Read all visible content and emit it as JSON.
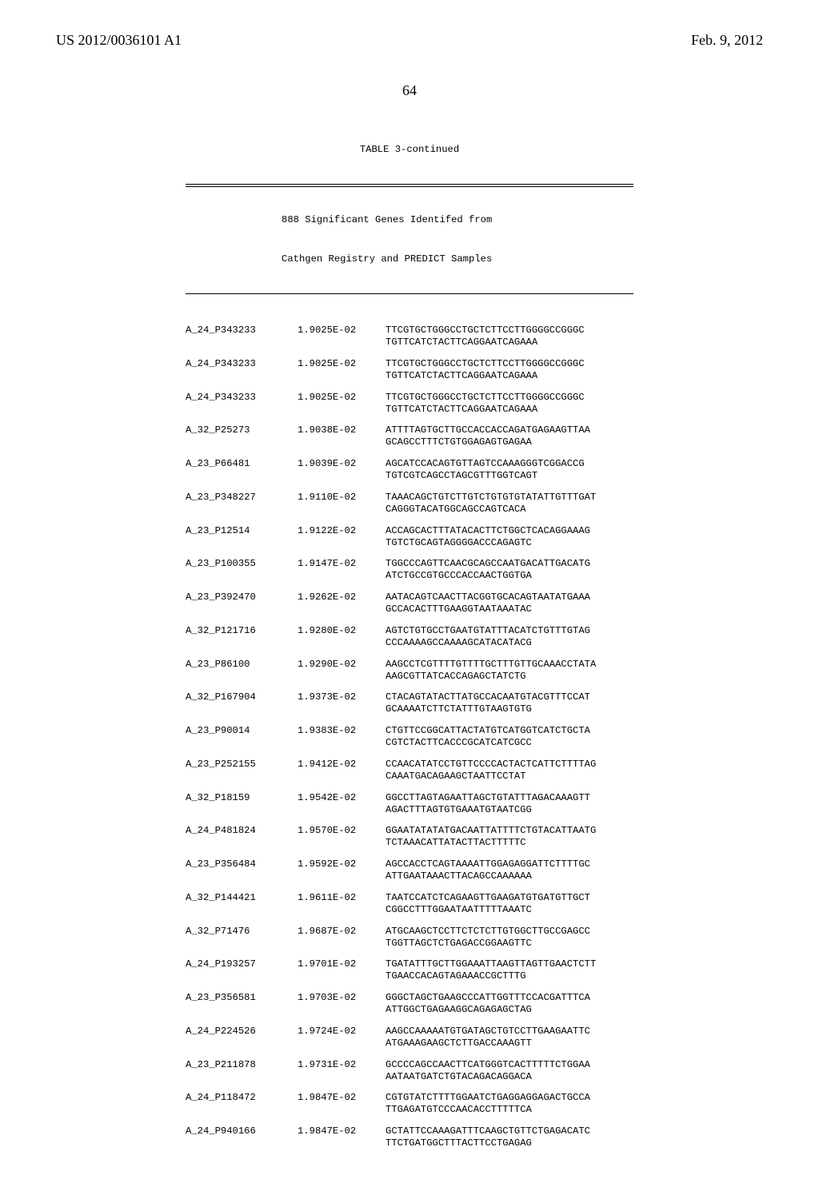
{
  "header": {
    "left": "US 2012/0036101 A1",
    "right": "Feb. 9, 2012"
  },
  "page_number": "64",
  "table": {
    "title": "TABLE 3-continued",
    "subtitle1": "888 Significant Genes Identifed from",
    "subtitle2": "Cathgen Registry and PREDICT Samples",
    "rows": [
      {
        "id": "A_24_P343233",
        "val": "1.9025E-02",
        "seq": [
          "TTCGTGCTGGGCCTGCTCTTCCTTGGGGCCGGGC",
          "TGTTCATCTACTTCAGGAATCAGAAA"
        ]
      },
      {
        "id": "A_24_P343233",
        "val": "1.9025E-02",
        "seq": [
          "TTCGTGCTGGGCCTGCTCTTCCTTGGGGCCGGGC",
          "TGTTCATCTACTTCAGGAATCAGAAA"
        ]
      },
      {
        "id": "A_24_P343233",
        "val": "1.9025E-02",
        "seq": [
          "TTCGTGCTGGGCCTGCTCTTCCTTGGGGCCGGGC",
          "TGTTCATCTACTTCAGGAATCAGAAA"
        ]
      },
      {
        "id": "A_32_P25273",
        "val": "1.9038E-02",
        "seq": [
          "ATTTTAGTGCTTGCCACCACCAGATGAGAAGTTAA",
          "GCAGCCTTTCTGTGGAGAGTGAGAA"
        ]
      },
      {
        "id": "A_23_P66481",
        "val": "1.9039E-02",
        "seq": [
          "AGCATCCACAGTGTTAGTCCAAAGGGTCGGACCG",
          "TGTCGTCAGCCTAGCGTTTGGTCAGT"
        ]
      },
      {
        "id": "A_23_P348227",
        "val": "1.9110E-02",
        "seq": [
          "TAAACAGCTGTCTTGTCTGTGTGTATATTGTTTGAT",
          "CAGGGTACATGGCAGCCAGTCACA"
        ]
      },
      {
        "id": "A_23_P12514",
        "val": "1.9122E-02",
        "seq": [
          "ACCAGCACTTTATACACTTCTGGCTCACAGGAAAG",
          "TGTCTGCAGTAGGGGACCCAGAGTC"
        ]
      },
      {
        "id": "A_23_P100355",
        "val": "1.9147E-02",
        "seq": [
          "TGGCCCAGTTCAACGCAGCCAATGACATTGACATG",
          "ATCTGCCGTGCCCACCAACTGGTGA"
        ]
      },
      {
        "id": "A_23_P392470",
        "val": "1.9262E-02",
        "seq": [
          "AATACAGTCAACTTACGGTGCACAGTAATATGAAA",
          "GCCACACTTTGAAGGTAATAAATAC"
        ]
      },
      {
        "id": "A_32_P121716",
        "val": "1.9280E-02",
        "seq": [
          "AGTCTGTGCCTGAATGTATTTACATCTGTTTGTAG",
          "CCCAAAAGCCAAAAGCATACATACG"
        ]
      },
      {
        "id": "A_23_P86100",
        "val": "1.9290E-02",
        "seq": [
          "AAGCCTCGTTTTGTTTTGCTTTGTTGCAAACCTATA",
          "AAGCGTTATCACCAGAGCTATCTG"
        ]
      },
      {
        "id": "A_32_P167904",
        "val": "1.9373E-02",
        "seq": [
          "CTACAGTATACTTATGCCACAATGTACGTTTCCAT",
          "GCAAAATCTTCTATTTGTAAGTGTG"
        ]
      },
      {
        "id": "A_23_P90014",
        "val": "1.9383E-02",
        "seq": [
          "CTGTTCCGGCATTACTATGTCATGGTCATCTGCTA",
          "CGTCTACTTCACCCGCATCATCGCC"
        ]
      },
      {
        "id": "A_23_P252155",
        "val": "1.9412E-02",
        "seq": [
          "CCAACATATCCTGTTCCCCACTACTCATTCTTTTAG",
          "CAAATGACAGAAGCTAATTCCTAT"
        ]
      },
      {
        "id": "A_32_P18159",
        "val": "1.9542E-02",
        "seq": [
          "GGCCTTAGTAGAATTAGCTGTATTTAGACAAAGTT",
          "AGACTTTAGTGTGAAATGTAATCGG"
        ]
      },
      {
        "id": "A_24_P481824",
        "val": "1.9570E-02",
        "seq": [
          "GGAATATATATGACAATTATTTTCTGTACATTAATG",
          "TCTAAACATTATACTTACTTTTTC"
        ]
      },
      {
        "id": "A_23_P356484",
        "val": "1.9592E-02",
        "seq": [
          "AGCCACCTCAGTAAAATTGGAGAGGATTCTTTTGC",
          "ATTGAATAAACTTACAGCCAAAAAA"
        ]
      },
      {
        "id": "A_32_P144421",
        "val": "1.9611E-02",
        "seq": [
          "TAATCCATCTCAGAAGTTGAAGATGTGATGTTGCT",
          "CGGCCTTTGGAATAATTTTTAAATC"
        ]
      },
      {
        "id": "A_32_P71476",
        "val": "1.9687E-02",
        "seq": [
          "ATGCAAGCTCCTTCTCTCTTGTGGCTTGCCGAGCC",
          "TGGTTAGCTCTGAGACCGGAAGTTC"
        ]
      },
      {
        "id": "A_24_P193257",
        "val": "1.9701E-02",
        "seq": [
          "TGATATTTGCTTGGAAATTAAGTTAGTTGAACTCTT",
          "TGAACCACAGTAGAAACCGCTTTG"
        ]
      },
      {
        "id": "A_23_P356581",
        "val": "1.9703E-02",
        "seq": [
          "GGGCTAGCTGAAGCCCATTGGTTTCCACGATTTCA",
          "ATTGGCTGAGAAGGCAGAGAGCTAG"
        ]
      },
      {
        "id": "A_24_P224526",
        "val": "1.9724E-02",
        "seq": [
          "AAGCCAAAAATGTGATAGCTGTCCTTGAAGAATTC",
          "ATGAAAGAAGCTCTTGACCAAAGTT"
        ]
      },
      {
        "id": "A_23_P211878",
        "val": "1.9731E-02",
        "seq": [
          "GCCCCAGCCAACTTCATGGGTCACTTTTTCTGGAA",
          "AATAATGATCTGTACAGACAGGACA"
        ]
      },
      {
        "id": "A_24_P118472",
        "val": "1.9847E-02",
        "seq": [
          "CGTGTATCTTTTGGAATCTGAGGAGGAGACTGCCA",
          "TTGAGATGTCCCAACACCTTTTTCA"
        ]
      },
      {
        "id": "A_24_P940166",
        "val": "1.9847E-02",
        "seq": [
          "GCTATTCCAAAGATTTCAAGCTGTTCTGAGACATC",
          "TTCTGATGGCTTTACTTCCTGAGAG"
        ]
      }
    ]
  }
}
